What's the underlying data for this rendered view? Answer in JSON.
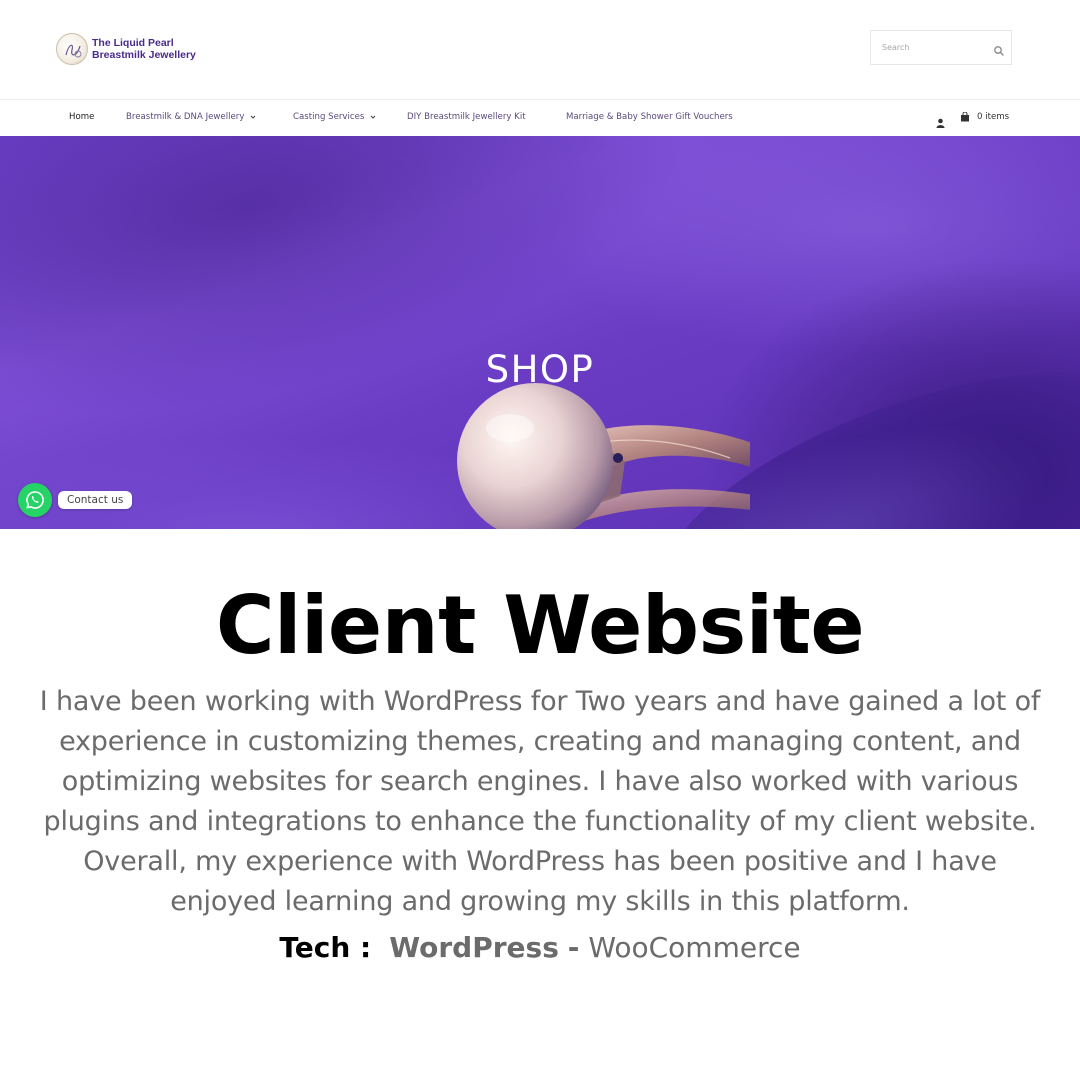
{
  "header": {
    "brand_line1": "The Liquid Pearl",
    "brand_line2": "Breastmilk Jewellery",
    "search_placeholder": "Search",
    "search_icon": "search-icon"
  },
  "nav": {
    "items": [
      {
        "label": "Home",
        "active": true,
        "has_dropdown": false
      },
      {
        "label": "Breastmilk & DNA Jewellery",
        "active": false,
        "has_dropdown": true
      },
      {
        "label": "Casting Services",
        "active": false,
        "has_dropdown": true
      },
      {
        "label": "DIY Breastmilk Jewellery Kit",
        "active": false,
        "has_dropdown": false
      },
      {
        "label": "Marriage & Baby Shower Gift Vouchers",
        "active": false,
        "has_dropdown": false
      }
    ],
    "account_icon": "user-icon",
    "cart_icon": "shopping-bag-icon",
    "cart_label": "0 items"
  },
  "hero": {
    "title": "SHOP",
    "accent_color": "#6b3fc6"
  },
  "whatsapp": {
    "icon": "whatsapp-icon",
    "label": "Contact us",
    "color": "#25d366"
  },
  "content": {
    "heading": "Client Website",
    "paragraph_lines": [
      "I have been working with WordPress for Two years and have gained a lot of",
      "experience in customizing themes, creating and managing content, and",
      "optimizing websites for search engines. I have also worked with various",
      "plugins and integrations to enhance the functionality of my client website.",
      "Overall, my experience with WordPress has been positive and I have",
      "enjoyed learning and growing my skills in this platform."
    ],
    "tech_label": "Tech :",
    "tech_primary": "WordPress",
    "tech_separator": "-",
    "tech_secondary": "WooCommerce"
  }
}
